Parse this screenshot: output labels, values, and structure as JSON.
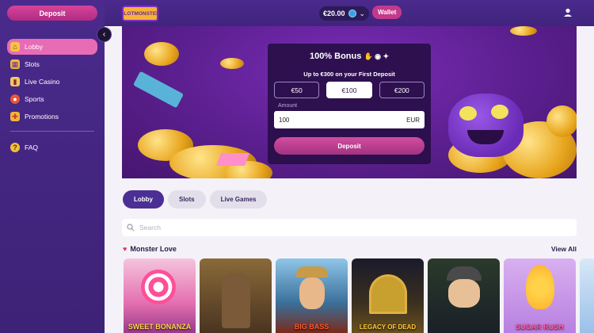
{
  "sidebar": {
    "deposit_label": "Deposit",
    "items": [
      {
        "label": "Lobby",
        "icon": "home-icon",
        "active": true
      },
      {
        "label": "Slots",
        "icon": "slot-machine-icon"
      },
      {
        "label": "Live Casino",
        "icon": "cards-icon"
      },
      {
        "label": "Sports",
        "icon": "ball-icon"
      },
      {
        "label": "Promotions",
        "icon": "gift-icon"
      }
    ],
    "faq_label": "FAQ"
  },
  "header": {
    "logo_text": "SLOTMONSTER",
    "balance": "€20.00",
    "wallet_label": "Wallet"
  },
  "bonus": {
    "title": "100% Bonus",
    "subtitle": "Up to €300 on your First Deposit",
    "options": [
      "€50",
      "€100",
      "€200"
    ],
    "selected": "€100",
    "amount_label": "Amount",
    "amount_value": "100",
    "currency": "EUR",
    "deposit_label": "Deposit"
  },
  "tabs": [
    "Lobby",
    "Slots",
    "Live Games"
  ],
  "search": {
    "placeholder": "Search"
  },
  "section": {
    "title": "Monster Love",
    "view_all": "View All"
  },
  "games": [
    {
      "title": "SWEET BONANZA",
      "bg": "#e9a0c9"
    },
    {
      "title": "",
      "bg": "#6b4a2a"
    },
    {
      "title": "BIG BASS",
      "bg": "#3a6f9a"
    },
    {
      "title": "LEGACY OF DEAD",
      "bg": "#2a2a40"
    },
    {
      "title": "",
      "bg": "#1f2a35"
    },
    {
      "title": "SUGAR RUSH",
      "bg": "#c88fe3"
    }
  ]
}
